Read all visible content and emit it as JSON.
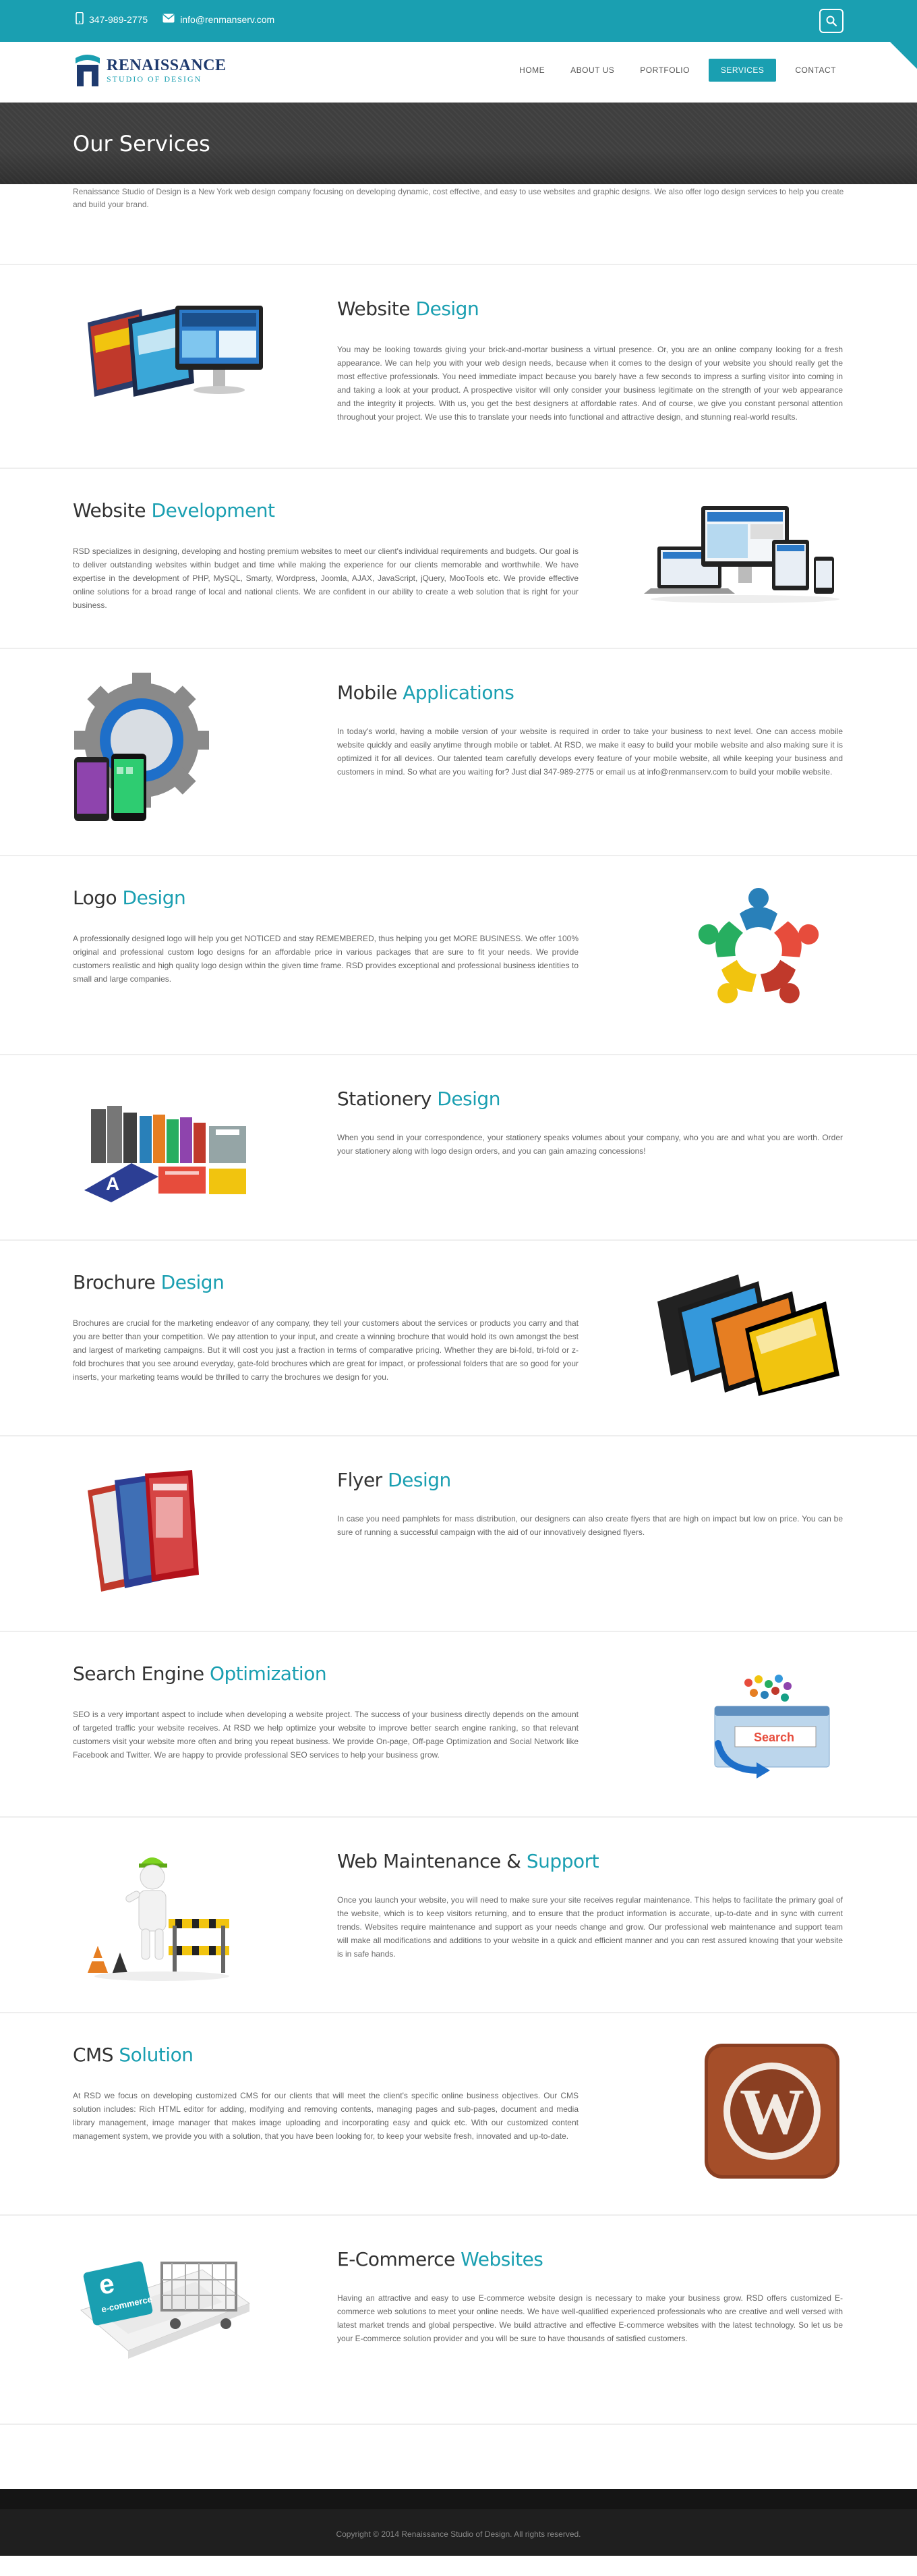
{
  "topbar": {
    "phone": "347-989-2775",
    "email": "info@renmanserv.com"
  },
  "logo": {
    "name": "RENAISSANCE",
    "tagline": "STUDIO OF DESIGN"
  },
  "nav": {
    "items": [
      "HOME",
      "ABOUT US",
      "PORTFOLIO",
      "SERVICES",
      "CONTACT"
    ],
    "active": "SERVICES"
  },
  "banner": {
    "title": "Our Services"
  },
  "intro": {
    "text": "Renaissance Studio of Design is a New York web design company focusing on developing dynamic, cost effective, and easy to use websites and graphic designs. We also offer logo design services to help you create and build your brand."
  },
  "services": [
    {
      "title_plain": "Website ",
      "title_accent": "Design",
      "text": "You may be looking towards giving your brick-and-mortar business a virtual presence. Or, you are an online company looking for a fresh appearance. We can help you with your web design needs, because when it comes to the design of your website you should really get the most effective professionals. You need immediate impact because you barely have a few seconds to impress a surfing visitor into coming in and taking a look at your product. A prospective visitor will only consider your business legitimate on the strength of your web appearance and the integrity it projects. With us, you get the best designers at affordable rates. And of course, we give you constant personal attention throughout your project. We use this to translate your needs into functional and attractive design, and stunning real-world results."
    },
    {
      "title_plain": "Website ",
      "title_accent": "Development",
      "text": "RSD specializes in designing, developing and hosting premium websites to meet our client's individual requirements and budgets. Our goal is to deliver outstanding websites within budget and time while making the experience for our clients memorable and worthwhile. We have expertise in the development of PHP, MySQL, Smarty, Wordpress, Joomla, AJAX, JavaScript, jQuery, MooTools etc. We provide effective online solutions for a broad range of local and national clients. We are confident in our ability to create a web solution that is right for your business."
    },
    {
      "title_plain": "Mobile ",
      "title_accent": "Applications",
      "text": "In today's world, having a mobile version of your website is required in order to take your business to next level. One can access mobile website quickly and easily anytime through mobile or tablet. At RSD, we make it easy to build your mobile website and also making sure it is optimized it for all devices. Our talented team carefully develops every feature of your mobile website, all while keeping your business and customers in mind. So what are you waiting for? Just dial 347-989-2775 or email us at info@renmanserv.com to build your mobile website."
    },
    {
      "title_plain": "Logo ",
      "title_accent": "Design",
      "text": "A professionally designed logo will help you get NOTICED and stay REMEMBERED, thus helping you get MORE BUSINESS. We offer 100% original and professional custom logo designs for an affordable price in various packages that are sure to fit your needs. We provide customers realistic and high quality logo design within the given time frame. RSD provides exceptional and professional business identities to small and large companies."
    },
    {
      "title_plain": "Stationery ",
      "title_accent": "Design",
      "text": "When you send in your correspondence, your stationery speaks volumes about your company, who you are and what you are worth. Order your stationery along with logo design orders, and you can gain amazing concessions!"
    },
    {
      "title_plain": "Brochure ",
      "title_accent": "Design",
      "text": "Brochures are crucial for the marketing endeavor of any company, they tell your customers about the services or products you carry and that you are better than your competition. We pay attention to your input, and create a winning brochure that would hold its own amongst the best and largest of marketing campaigns. But it will cost you just a fraction in terms of comparative pricing. Whether they are bi-fold, tri-fold or z-fold brochures that you see around everyday, gate-fold brochures which are great for impact, or professional folders that are so good for your inserts, your marketing teams would be thrilled to carry the brochures we design for you."
    },
    {
      "title_plain": "Flyer ",
      "title_accent": "Design",
      "text": "In case you need pamphlets for mass distribution, our designers can also create flyers that are high on impact but low on price. You can be sure of running a successful campaign with the aid of our innovatively designed flyers."
    },
    {
      "title_plain": "Search Engine ",
      "title_accent": "Optimization",
      "text": "SEO is a very important aspect to include when developing a website project. The success of your business directly depends on the amount of targeted traffic your website receives. At RSD we help optimize your website to improve better search engine ranking, so that relevant customers visit your website more often and bring you repeat business. We provide On-page, Off-page Optimization and Social Network like Facebook and Twitter. We are happy to provide professional SEO services to help your business grow."
    },
    {
      "title_plain": "Web Maintenance & ",
      "title_accent": "Support",
      "text": "Once you launch your website, you will need to make sure your site receives regular maintenance. This helps to facilitate the primary goal of the website, which is to keep visitors returning, and to ensure that the product information is accurate, up-to-date and in sync with current trends. Websites require maintenance and support as your needs change and grow. Our professional web maintenance and support team will make all modifications and additions to your website in a quick and efficient manner and you can rest assured knowing that your website is in safe hands."
    },
    {
      "title_plain": "CMS ",
      "title_accent": "Solution",
      "text": "At RSD we focus on developing customized CMS for our clients that will meet the client's specific online business objectives. Our CMS solution includes: Rich HTML editor for adding, modifying and removing contents, managing pages and sub-pages, document and media library management, image manager that makes image uploading and incorporating easy and quick etc. With our customized content management system, we provide you with a solution, that you have been looking for, to keep your website fresh, innovated and up-to-date."
    },
    {
      "title_plain": "E-Commerce ",
      "title_accent": "Websites",
      "text": "Having an attractive and easy to use E-commerce website design is necessary to make your business grow. RSD offers customized E-commerce web solutions to meet your online needs. We have well-qualified experienced professionals who are creative and well versed with latest market trends and global perspective. We build attractive and effective E-commerce websites with the latest technology. So let us be your E-commerce solution provider and you will be sure to have thousands of satisfied customers."
    }
  ],
  "art": {
    "seo_word": "Search",
    "ecommerce_word": "e-commerce",
    "wordpress_letter": "W"
  },
  "footer": {
    "copyright": "Copyright © 2014 Renaissance Studio of Design. All rights reserved."
  },
  "colors": {
    "accent": "#1a9fb1",
    "banner": "#3f3f3f",
    "footer": "#1f1f1f",
    "heading": "#333333"
  },
  "icons": [
    "phone-icon",
    "mail-icon",
    "search-icon",
    "logo-mark"
  ]
}
